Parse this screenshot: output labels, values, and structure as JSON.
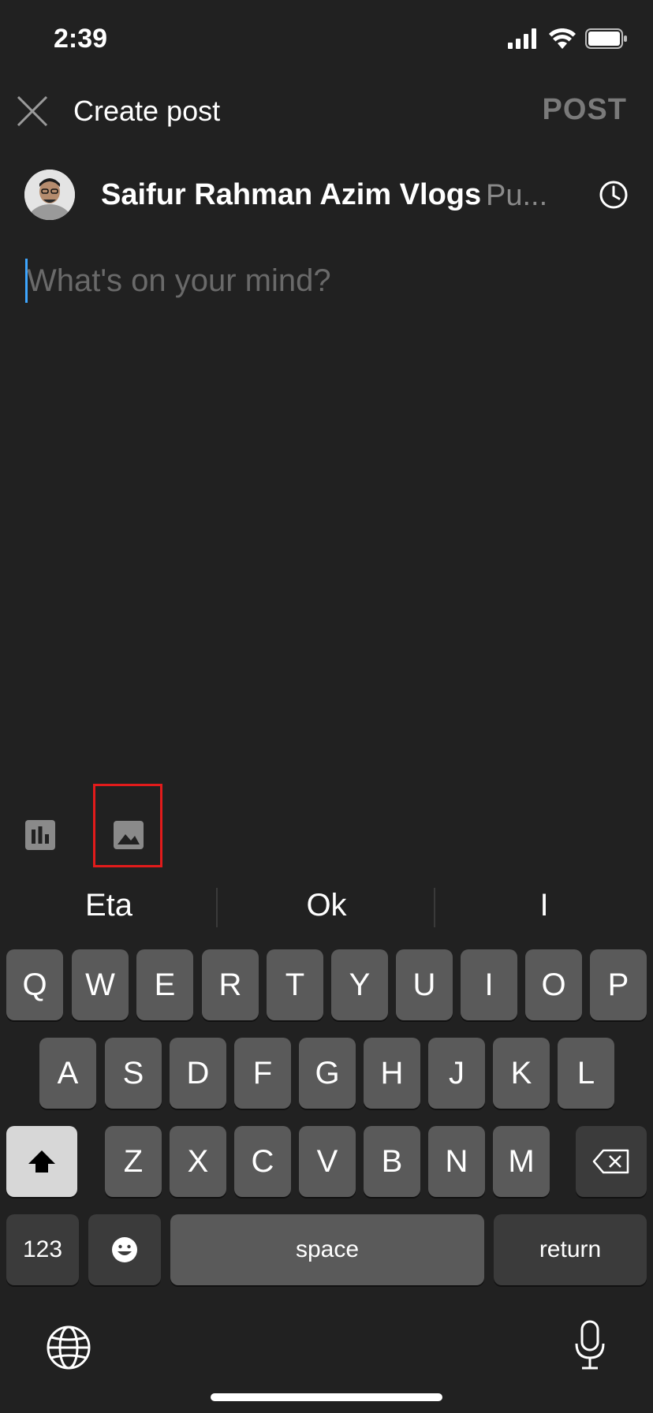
{
  "status_bar": {
    "time": "2:39"
  },
  "header": {
    "title": "Create post",
    "post_label": "POST"
  },
  "author": {
    "name": "Saifur Rahman Azim Vlogs",
    "visibility": "Pu..."
  },
  "composer": {
    "placeholder": "What's on your mind?"
  },
  "toolbar": {
    "icons": [
      "poll-icon",
      "image-icon"
    ]
  },
  "keyboard": {
    "suggestions": [
      "Eta",
      "Ok",
      "I"
    ],
    "row1": [
      "Q",
      "W",
      "E",
      "R",
      "T",
      "Y",
      "U",
      "I",
      "O",
      "P"
    ],
    "row2": [
      "A",
      "S",
      "D",
      "F",
      "G",
      "H",
      "J",
      "K",
      "L"
    ],
    "row3": [
      "Z",
      "X",
      "C",
      "V",
      "B",
      "N",
      "M"
    ],
    "numbers_label": "123",
    "space_label": "space",
    "return_label": "return"
  },
  "colors": {
    "accent_cursor": "#3ea6ff",
    "highlight_box": "#e21b1b",
    "background": "#212121"
  }
}
